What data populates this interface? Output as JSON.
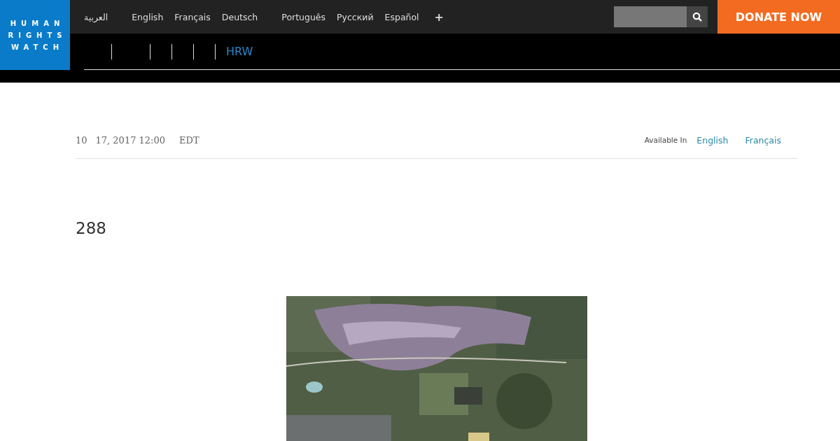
{
  "logo": {
    "lines": [
      "HUMAN",
      "RIGHTS",
      "WATCH"
    ]
  },
  "languages": [
    "العربية",
    "English",
    "Français",
    "Deutsch",
    "Português",
    "Русский",
    "Español"
  ],
  "more_languages": "+",
  "donate": "DONATE NOW",
  "breadcrumb": {
    "current": "HRW"
  },
  "meta": {
    "date_parts": [
      "10",
      "17, 2017 12:00",
      "EDT"
    ],
    "available_label": "Available In",
    "available_links": [
      "English",
      "Français"
    ]
  },
  "title": "288"
}
